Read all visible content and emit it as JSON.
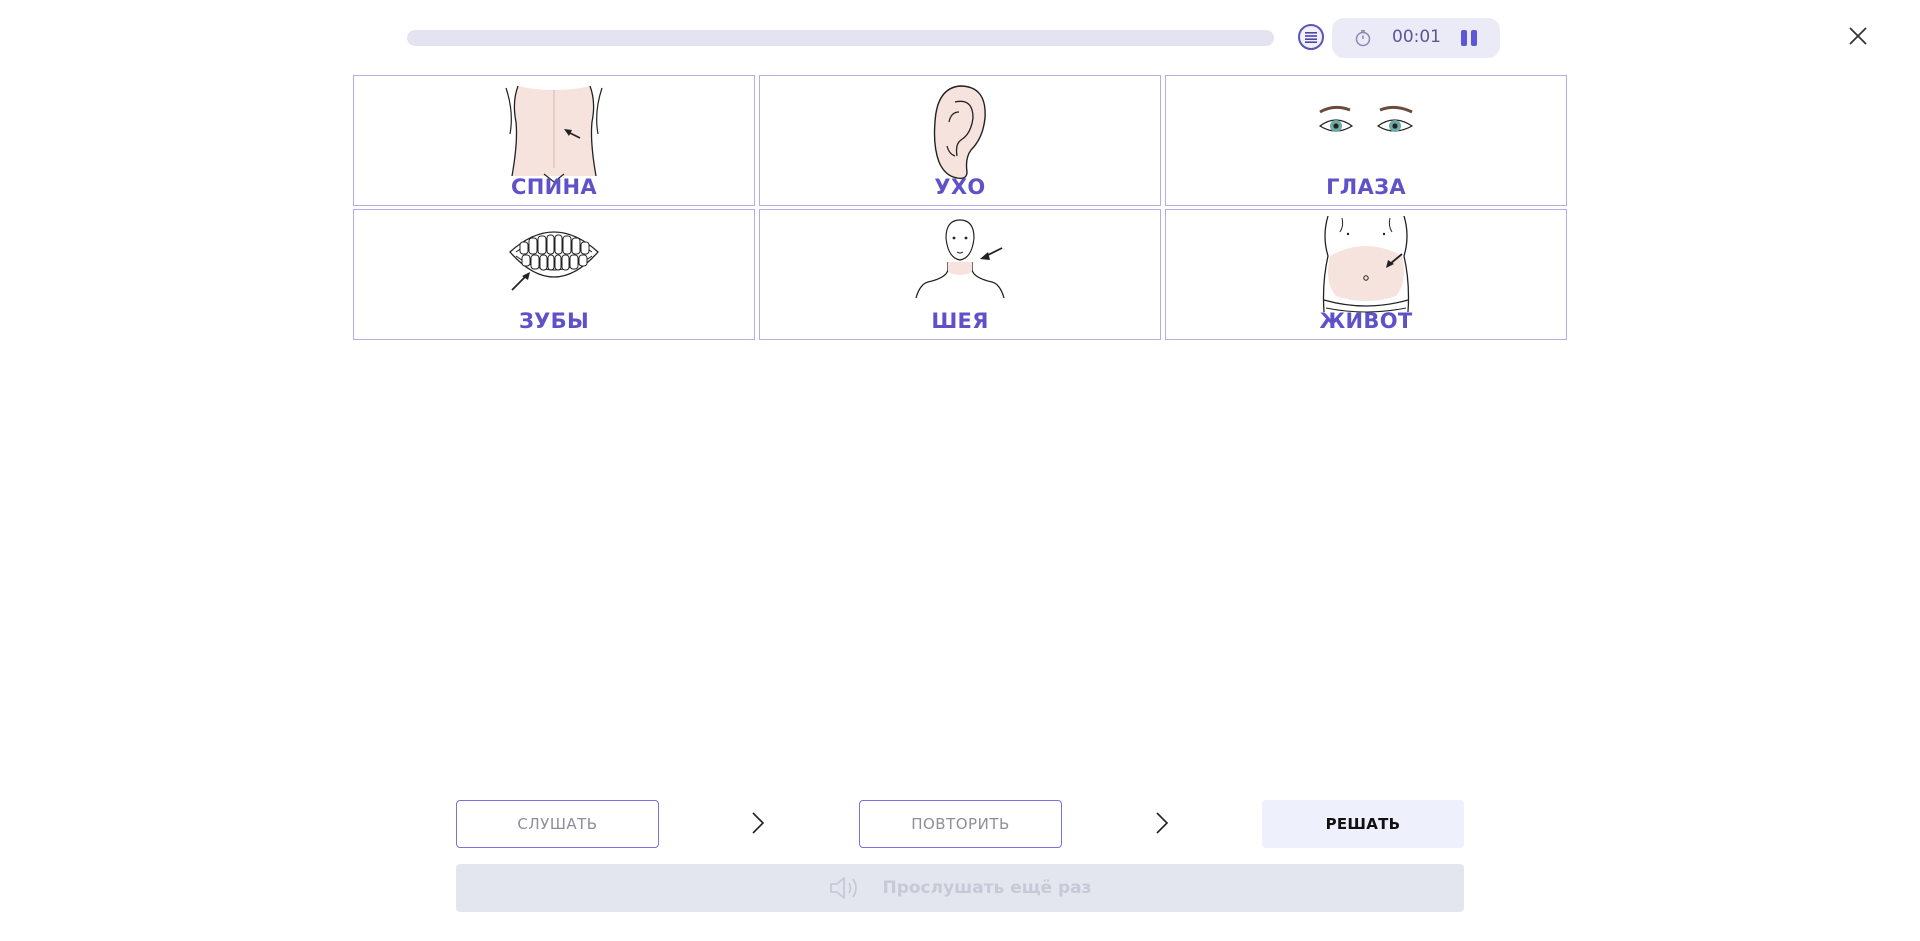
{
  "top_bar": {
    "progress_fraction": 0.0,
    "menu_icon": "list-icon",
    "timer_icon": "stopwatch-icon",
    "timer": "00:01",
    "pause_icon": "pause-icon",
    "close_icon": "close-icon"
  },
  "cards": [
    {
      "label": "СПИНА",
      "icon": "back-illustration"
    },
    {
      "label": "УХО",
      "icon": "ear-illustration"
    },
    {
      "label": "ГЛАЗА",
      "icon": "eyes-illustration"
    },
    {
      "label": "ЗУБЫ",
      "icon": "teeth-illustration"
    },
    {
      "label": "ШЕЯ",
      "icon": "neck-illustration"
    },
    {
      "label": "ЖИВОТ",
      "icon": "belly-illustration"
    }
  ],
  "controls": {
    "listen": "СЛУШАТЬ",
    "repeat": "ПОВТОРИТЬ",
    "solve": "РЕШАТЬ",
    "replay": "Прослушать ещё раз",
    "replay_icon": "speaker-icon",
    "arrow_icon": "chevron-right-icon"
  },
  "colors": {
    "accent": "#5f52c8",
    "card_border": "#b3aee6",
    "skin": "#f6e3dd"
  }
}
